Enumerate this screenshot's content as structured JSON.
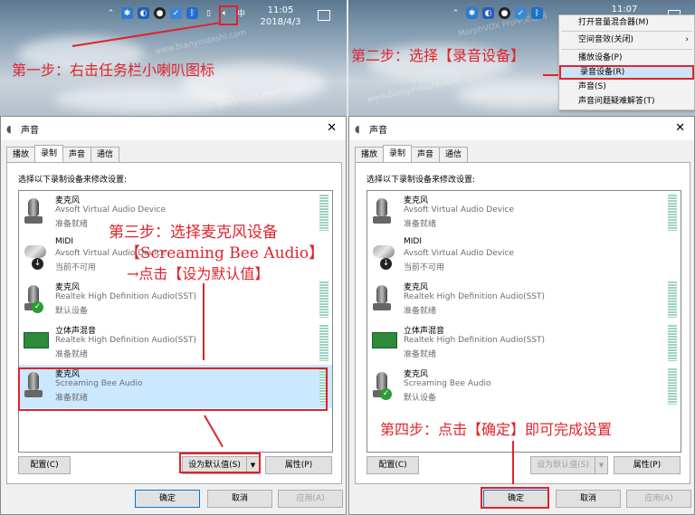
{
  "taskbar_left": {
    "time": "11:05",
    "date": "2018/4/3"
  },
  "taskbar_right": {
    "time": "11:07"
  },
  "watermarks": [
    "www.bianyindashi.com",
    "MorphVOX Pro中文官网",
    "www.bianyindashi.com",
    "MorphVOX Pro中文官网"
  ],
  "steps": {
    "step1": "第一步：右击任务栏小喇叭图标",
    "step2": "第二步：选择【录音设备】",
    "step3_line1": "第三步：选择麦克风设备",
    "step3_line2": "【Screaming Bee Audio】",
    "step3_line3": "→点击【设为默认值】",
    "step4": "第四步：点击【确定】即可完成设置"
  },
  "context_menu": {
    "items": [
      {
        "label": "打开音量混合器(M)"
      },
      {
        "label": "空间音效(关闭)",
        "submenu": "›"
      },
      {
        "label": "播放设备(P)"
      },
      {
        "label": "录音设备(R)"
      },
      {
        "label": "声音(S)"
      },
      {
        "label": "声音问题疑难解答(T)"
      }
    ]
  },
  "dialog": {
    "title": "声音",
    "close": "✕",
    "tabs": [
      "播放",
      "录制",
      "声音",
      "通信"
    ],
    "instruction": "选择以下录制设备来修改设置:",
    "buttons": {
      "configure": "配置(C)",
      "set_default": "设为默认值(S)",
      "properties": "属性(P)",
      "ok": "确定",
      "cancel": "取消",
      "apply": "应用(A)"
    }
  },
  "devices_left": [
    {
      "name": "麦克风",
      "desc": "Avsoft Virtual Audio Device",
      "status": "准备就绪"
    },
    {
      "name": "MIDI",
      "desc": "Avsoft Virtual Audio Device",
      "status": "当前不可用"
    },
    {
      "name": "麦克风",
      "desc": "Realtek High Definition Audio(SST)",
      "status": "默认设备"
    },
    {
      "name": "立体声混音",
      "desc": "Realtek High Definition Audio(SST)",
      "status": "准备就绪"
    },
    {
      "name": "麦克风",
      "desc": "Screaming Bee Audio",
      "status": "准备就绪"
    }
  ],
  "devices_right": [
    {
      "name": "麦克风",
      "desc": "Avsoft Virtual Audio Device",
      "status": "准备就绪"
    },
    {
      "name": "MIDI",
      "desc": "Avsoft Virtual Audio Device",
      "status": "当前不可用"
    },
    {
      "name": "麦克风",
      "desc": "Realtek High Definition Audio(SST)",
      "status": "准备就绪"
    },
    {
      "name": "立体声混音",
      "desc": "Realtek High Definition Audio(SST)",
      "status": "准备就绪"
    },
    {
      "name": "麦克风",
      "desc": "Screaming Bee Audio",
      "status": "默认设备"
    }
  ],
  "colors": {
    "annotation_red": "#e0232b",
    "selection": "#cce8ff"
  }
}
